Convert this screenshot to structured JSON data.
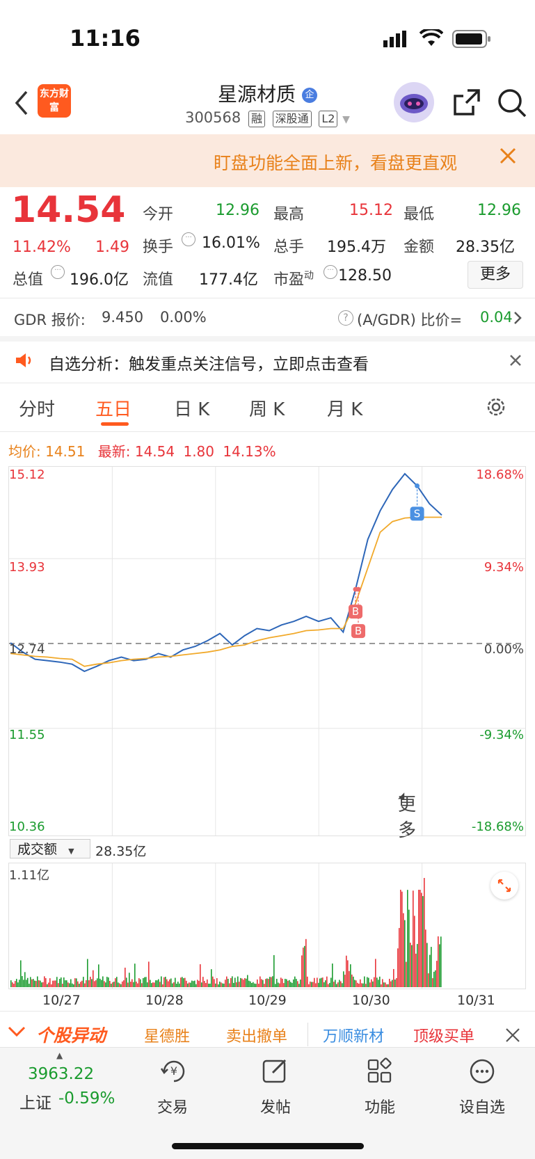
{
  "status_bar": {
    "time": "11:16"
  },
  "header": {
    "logo_text": "东方财富",
    "stock_name": "星源材质",
    "badge": "企",
    "code": "300568",
    "tags": [
      "融",
      "深股通",
      "L2"
    ]
  },
  "banner": {
    "text": "盯盘功能全面上新，看盘更直观"
  },
  "quote": {
    "price": "14.54",
    "change_pct": "11.42%",
    "change": "1.49",
    "open_label": "今开",
    "open": "12.96",
    "high_label": "最高",
    "high": "15.12",
    "low_label": "最低",
    "low": "12.96",
    "turnover_label": "换手",
    "turnover": "16.01%",
    "volume_label": "总手",
    "volume": "195.4万",
    "amount_label": "金额",
    "amount": "28.35亿",
    "mktcap_label": "总值",
    "mktcap": "196.0亿",
    "float_label": "流值",
    "float": "177.4亿",
    "pe_label": "市盈",
    "pe_sup": "动",
    "pe": "128.50",
    "more_button": "更多"
  },
  "gdr": {
    "label": "GDR 报价:",
    "price": "9.450",
    "pct": "0.00%",
    "ratio_label": "(A/GDR) 比价=",
    "ratio": "0.04"
  },
  "analysis": {
    "text": "自选分析：触发重点关注信号，立即点击查看"
  },
  "tabs": [
    {
      "label": "分时",
      "active": false
    },
    {
      "label": "五日",
      "active": true
    },
    {
      "label": "日 K",
      "active": false
    },
    {
      "label": "周 K",
      "active": false
    },
    {
      "label": "月 K",
      "active": false
    },
    {
      "label": "更多",
      "active": false
    }
  ],
  "chart_info": {
    "avg_label": "均价:",
    "avg": "14.51",
    "latest_label": "最新:",
    "latest": "14.54",
    "latest_change": "1.80",
    "latest_pct": "14.13%"
  },
  "chart_data": {
    "type": "line",
    "y_left_ticks": [
      "15.12",
      "13.93",
      "12.74",
      "11.55",
      "10.36"
    ],
    "y_right_ticks": [
      "18.68%",
      "9.34%",
      "0.00%",
      "-9.34%",
      "-18.68%"
    ],
    "ylim": [
      10.36,
      15.12
    ],
    "baseline": 12.74,
    "x_dates": [
      "10/27",
      "10/28",
      "10/29",
      "10/30",
      "10/31"
    ],
    "series": [
      {
        "name": "",
        "color": "#2d66b8",
        "values": [
          12.75,
          12.62,
          12.52,
          12.5,
          12.48,
          12.45,
          12.35,
          12.42,
          12.5,
          12.55,
          12.5,
          12.52,
          12.6,
          12.55,
          12.65,
          12.7,
          12.78,
          12.88,
          12.72,
          12.85,
          12.95,
          12.92,
          13.0,
          13.05,
          13.12,
          13.05,
          13.1,
          12.9,
          13.5,
          14.2,
          14.6,
          14.9,
          15.12,
          14.95,
          14.7,
          14.54
        ]
      },
      {
        "name": "",
        "color": "#f1a92a",
        "values": [
          12.6,
          12.58,
          12.56,
          12.55,
          12.53,
          12.52,
          12.42,
          12.45,
          12.47,
          12.5,
          12.52,
          12.53,
          12.55,
          12.56,
          12.58,
          12.6,
          12.62,
          12.65,
          12.7,
          12.72,
          12.78,
          12.82,
          12.85,
          12.88,
          12.92,
          12.93,
          12.95,
          12.95,
          13.3,
          13.8,
          14.3,
          14.45,
          14.5,
          14.51,
          14.51,
          14.51
        ]
      }
    ],
    "markers": [
      {
        "label": "B",
        "color": "#ee6b6b"
      },
      {
        "label": "B",
        "color": "#ee6b6b"
      },
      {
        "label": "S",
        "color": "#4a90e2"
      }
    ]
  },
  "volume": {
    "selector_label": "成交额",
    "total": "28.35亿",
    "max_label": "1.11亿"
  },
  "news_bar": {
    "title": "个股异动",
    "items": [
      "星德胜",
      "卖出撤单",
      "万顺新材",
      "顶级买单"
    ]
  },
  "bottom_nav": {
    "index_value": "3963.22",
    "index_name": "上证",
    "index_pct": "-0.59%",
    "items": [
      "交易",
      "发帖",
      "功能",
      "设自选"
    ]
  }
}
